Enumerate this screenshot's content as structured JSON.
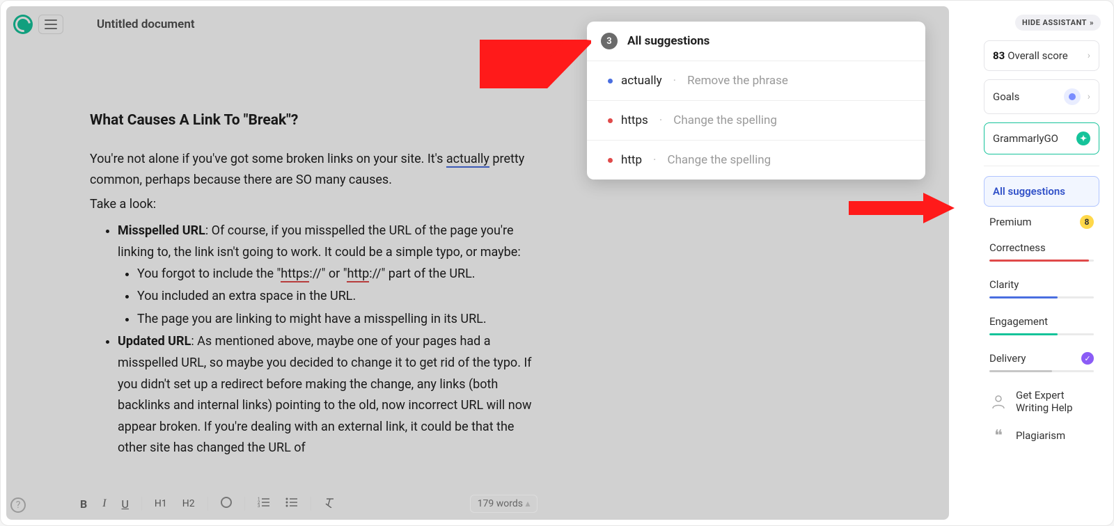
{
  "header": {
    "doc_title": "Untitled document"
  },
  "document": {
    "heading": "What Causes A Link To \"Break\"?",
    "para1_pre": "You're not alone if you've got some broken links on your site. It's ",
    "para1_underlined": "actually",
    "para1_post": " pretty common, perhaps because there are SO many causes.",
    "para2": "Take a look:",
    "bullet1_strong": "Misspelled URL",
    "bullet1_text": ": Of course, if you misspelled the URL of the page you're linking to, the link isn't going to work. It could be a simple typo, or maybe:",
    "sub1_pre": "You forgot to include the \"",
    "sub1_https": "https",
    "sub1_mid": "://\" or \"",
    "sub1_http": "http",
    "sub1_post": "://\" part of the URL.",
    "sub2": "You included an extra space in the URL.",
    "sub3": "The page you are linking to might have a misspelling in its URL.",
    "bullet2_strong": "Updated URL",
    "bullet2_text": ": As mentioned above, maybe one of your pages had a misspelled URL, so maybe you decided to change it to get rid of the typo. If you didn't set up a redirect before making the change, any links (both backlinks and internal links) pointing to the old, now incorrect URL will now appear broken. If you're dealing with an external link, it could be that the other site has changed the URL of"
  },
  "toolbar": {
    "bold": "B",
    "italic": "I",
    "underline": "U",
    "h1": "H1",
    "h2": "H2",
    "word_count": "179 words"
  },
  "popup": {
    "count": "3",
    "title": "All suggestions",
    "items": [
      {
        "color": "blue",
        "word": "actually",
        "hint": "Remove the phrase"
      },
      {
        "color": "red",
        "word": "https",
        "hint": "Change the spelling"
      },
      {
        "color": "red",
        "word": "http",
        "hint": "Change the spelling"
      }
    ]
  },
  "panel": {
    "hide": "HIDE ASSISTANT",
    "score_num": "83",
    "score_label": "Overall score",
    "goals": "Goals",
    "grammarly_go": "GrammarlyGO",
    "all_suggestions": "All suggestions",
    "premium": "Premium",
    "premium_count": "8",
    "correctness": "Correctness",
    "clarity": "Clarity",
    "engagement": "Engagement",
    "delivery": "Delivery",
    "expert_l1": "Get Expert",
    "expert_l2": "Writing Help",
    "plagiarism": "Plagiarism"
  }
}
